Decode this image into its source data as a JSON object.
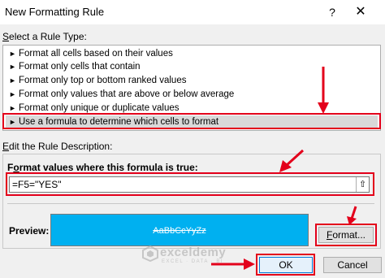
{
  "window": {
    "title": "New Formatting Rule",
    "help_glyph": "?",
    "close_glyph": "✕"
  },
  "rule_type": {
    "label_prefix": "S",
    "label_rest": "elect a Rule Type:",
    "items": [
      {
        "label": "Format all cells based on their values",
        "selected": false
      },
      {
        "label": "Format only cells that contain",
        "selected": false
      },
      {
        "label": "Format only top or bottom ranked values",
        "selected": false
      },
      {
        "label": "Format only values that are above or below average",
        "selected": false
      },
      {
        "label": "Format only unique or duplicate values",
        "selected": false
      },
      {
        "label": "Use a formula to determine which cells to format",
        "selected": true
      }
    ],
    "arrow_glyph": "►"
  },
  "description": {
    "label_prefix": "E",
    "label_rest": "dit the Rule Description:",
    "formula_label_pre": "F",
    "formula_label_u": "o",
    "formula_label_rest": "rmat values where this formula is true:",
    "formula_value": "=F5=\"YES\"",
    "collapse_glyph": "⇧",
    "preview_label": "Preview:",
    "preview_sample": "AaBbCcYyZz",
    "format_button_pre": "",
    "format_button_u": "F",
    "format_button_rest": "ormat..."
  },
  "buttons": {
    "ok": "OK",
    "cancel": "Cancel"
  },
  "watermark": {
    "name": "exceldemy",
    "tagline": "EXCEL · DATA · BI"
  },
  "colors": {
    "preview_fill": "#00b0f0",
    "annotation": "#e3001b"
  }
}
